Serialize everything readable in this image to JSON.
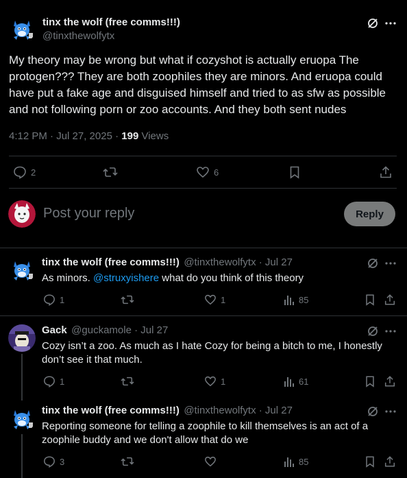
{
  "main_post": {
    "author_name": "tinx the wolf (free comms!!!)",
    "handle": "@tinxthewolfytx",
    "text": "My theory may be wrong but what if cozyshot is actually eruopa The protogen??? They are both zoophiles they are minors. And  eruopa could have put a fake age and disguised himself and tried to as sfw as possible and not following porn or zoo accounts. And they both sent nudes",
    "timestamp": "4:12 PM · Jul 27, 2025 · ",
    "views_count": "199",
    "views_label": " Views",
    "reply_count": "2",
    "repost_count": "",
    "like_count": "6"
  },
  "composer": {
    "placeholder": "Post your reply",
    "reply_button": "Reply"
  },
  "replies": [
    {
      "author_name": "tinx the wolf (free comms!!!)",
      "handle": "@tinxthewolfytx",
      "time": "Jul 27",
      "text_pre": "As minors. ",
      "mention": "@struxyishere",
      "text_post": " what do you think of this theory",
      "reply_count": "1",
      "like_count": "1",
      "views": "85"
    },
    {
      "author_name": "Gack",
      "handle": "@guckamole",
      "time": "Jul 27",
      "text": "Cozy isn’t a zoo. As much as I hate Cozy for being a bitch to me, I honestly don’t see it that much.",
      "reply_count": "1",
      "like_count": "1",
      "views": "61"
    },
    {
      "author_name": "tinx the wolf (free comms!!!)",
      "handle": "@tinxthewolfytx",
      "time": "Jul 27",
      "text": "Reporting someone for telling a zoophile to kill themselves is an act of a zoophile buddy and we don't allow that do we",
      "reply_count": "3",
      "like_count": "",
      "views": "85"
    }
  ],
  "separator": " · ",
  "colors": {
    "background": "#000000",
    "text": "#e7e9ea",
    "muted": "#71767b",
    "link": "#1d9bf0",
    "divider": "#2f3336",
    "reply_button_bg": "#787a7a"
  }
}
